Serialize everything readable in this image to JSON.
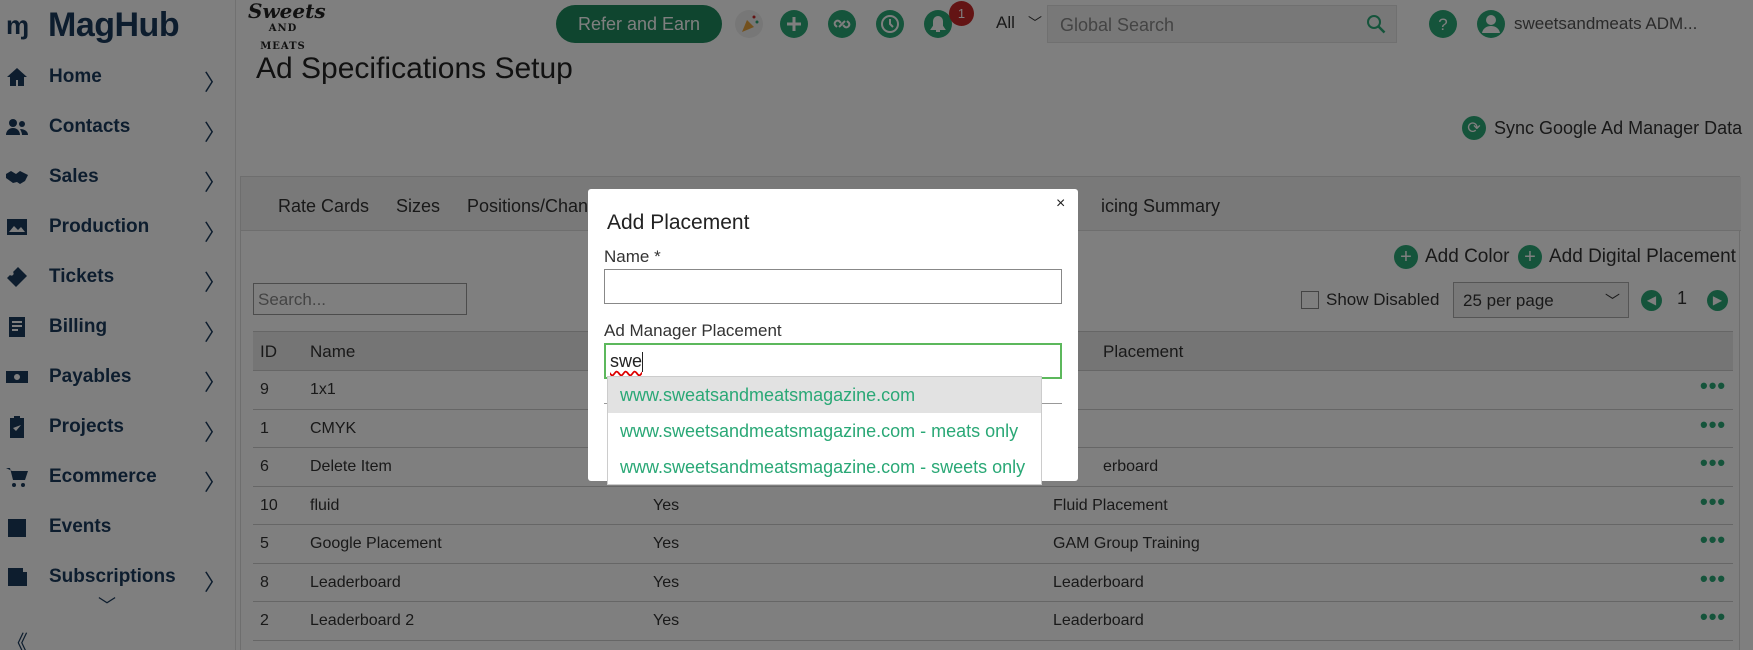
{
  "app": {
    "logo": "MagHub",
    "brand_line1": "Sweets",
    "brand_line2": "AND MEATS"
  },
  "sidebar": {
    "items": [
      {
        "label": "Home",
        "icon": "home-icon"
      },
      {
        "label": "Contacts",
        "icon": "contacts-icon"
      },
      {
        "label": "Sales",
        "icon": "handshake-icon"
      },
      {
        "label": "Production",
        "icon": "image-icon"
      },
      {
        "label": "Tickets",
        "icon": "ticket-icon"
      },
      {
        "label": "Billing",
        "icon": "invoice-icon"
      },
      {
        "label": "Payables",
        "icon": "money-icon"
      },
      {
        "label": "Projects",
        "icon": "clipboard-icon"
      },
      {
        "label": "Ecommerce",
        "icon": "cart-icon"
      },
      {
        "label": "Events",
        "icon": "calendar-icon"
      },
      {
        "label": "Subscriptions",
        "icon": "subscriptions-icon"
      }
    ],
    "more": "﹀",
    "collapse": "《"
  },
  "topbar": {
    "refer_label": "Refer and Earn",
    "notifications_count": "1",
    "scope": "All",
    "search_placeholder": "Global Search",
    "user": "sweetsandmeats ADM..."
  },
  "page": {
    "title": "Ad Specifications Setup",
    "sync_label": "Sync Google Ad Manager Data",
    "tabs": [
      "Rate Cards",
      "Sizes",
      "Positions/Chan",
      "icing Summary"
    ],
    "add_color": "Add Color",
    "add_digital": "Add Digital Placement",
    "search_placeholder": "Search...",
    "show_disabled": "Show Disabled",
    "per_page": "25 per page",
    "page": "1",
    "columns": {
      "id": "ID",
      "name": "Name",
      "placement": "Placement"
    },
    "rows": [
      {
        "id": "9",
        "name": "1x1",
        "active": "",
        "placement": ""
      },
      {
        "id": "1",
        "name": "CMYK",
        "active": "",
        "placement": ""
      },
      {
        "id": "6",
        "name": "Delete Item",
        "active": "",
        "placement": "erboard"
      },
      {
        "id": "10",
        "name": "fluid",
        "active": "Yes",
        "placement": "Fluid Placement"
      },
      {
        "id": "5",
        "name": "Google Placement",
        "active": "Yes",
        "placement": "GAM Group Training"
      },
      {
        "id": "8",
        "name": "Leaderboard",
        "active": "Yes",
        "placement": "Leaderboard"
      },
      {
        "id": "2",
        "name": "Leaderboard 2",
        "active": "Yes",
        "placement": "Leaderboard"
      }
    ]
  },
  "modal": {
    "title": "Add Placement",
    "close": "×",
    "name_label": "Name *",
    "name_value": "",
    "placement_label": "Ad Manager Placement",
    "placement_value": "swe",
    "options": [
      "www.sweatsandmeatsmagazine.com",
      "www.sweetsandmeatsmagazine.com - meats only",
      "www.sweetsandmeatsmagazine.com - sweets only"
    ]
  },
  "colors": {
    "accent": "#2aa876",
    "brand": "#1b3a5c",
    "refer": "#1f8a5e",
    "badge": "#c62828"
  }
}
